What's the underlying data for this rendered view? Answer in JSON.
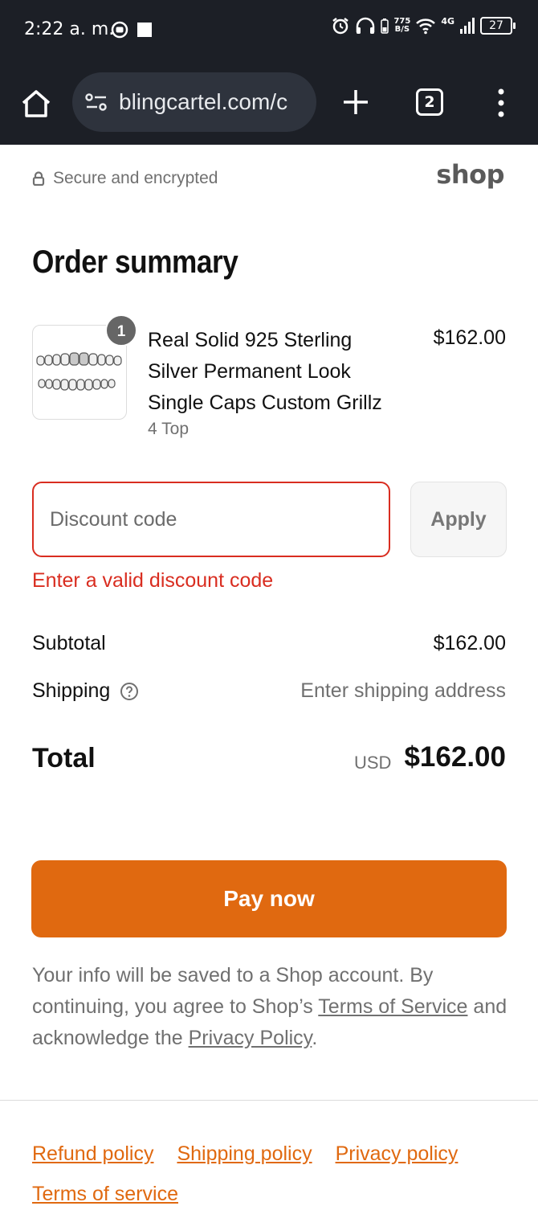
{
  "status_bar": {
    "time": "2:22 a. m.",
    "speed_value": "775",
    "speed_unit": "B/S",
    "network": "4G",
    "battery": "27"
  },
  "browser": {
    "url": "blingcartel.com/c",
    "tab_count": "2"
  },
  "header": {
    "secure_text": "Secure and encrypted",
    "shop_logo": "shop"
  },
  "order_summary": {
    "title": "Order summary",
    "item": {
      "quantity": "1",
      "name": "Real Solid 925 Sterling Silver Permanent Look Single Caps Custom Grillz",
      "variant": "4 Top",
      "price": "$162.00"
    }
  },
  "discount": {
    "placeholder": "Discount code",
    "apply_label": "Apply",
    "error": "Enter a valid discount code"
  },
  "totals": {
    "subtotal_label": "Subtotal",
    "subtotal_value": "$162.00",
    "shipping_label": "Shipping",
    "shipping_value": "Enter shipping address",
    "total_label": "Total",
    "currency": "USD",
    "total_value": "$162.00"
  },
  "pay": {
    "label": "Pay now"
  },
  "disclaimer": {
    "part1": "Your info will be saved to a Shop account. By continuing, you agree to Shop’s ",
    "terms_link": "Terms of Service",
    "part2": " and acknowledge the ",
    "privacy_link": "Privacy Policy",
    "part3": "."
  },
  "footer": {
    "links": [
      "Refund policy",
      "Shipping policy",
      "Privacy policy",
      "Terms of service"
    ]
  },
  "colors": {
    "accent": "#e06910",
    "error": "#d92d20",
    "browser_bg": "#1c1f26"
  }
}
